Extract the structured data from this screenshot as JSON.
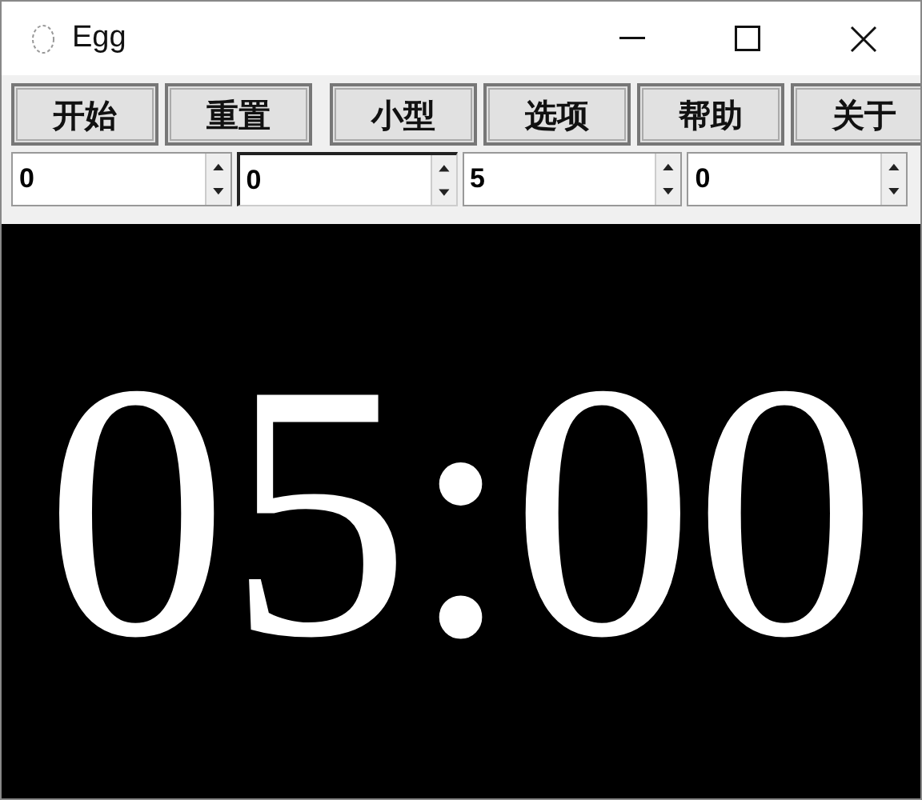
{
  "window": {
    "title": "Egg"
  },
  "buttons": [
    "开始",
    "重置",
    "小型",
    "选项",
    "帮助",
    "关于"
  ],
  "spinners": [
    {
      "value": "0",
      "focused": false
    },
    {
      "value": "0",
      "focused": true
    },
    {
      "value": "5",
      "focused": false
    },
    {
      "value": "0",
      "focused": false
    }
  ],
  "display": {
    "time": "05:00"
  }
}
